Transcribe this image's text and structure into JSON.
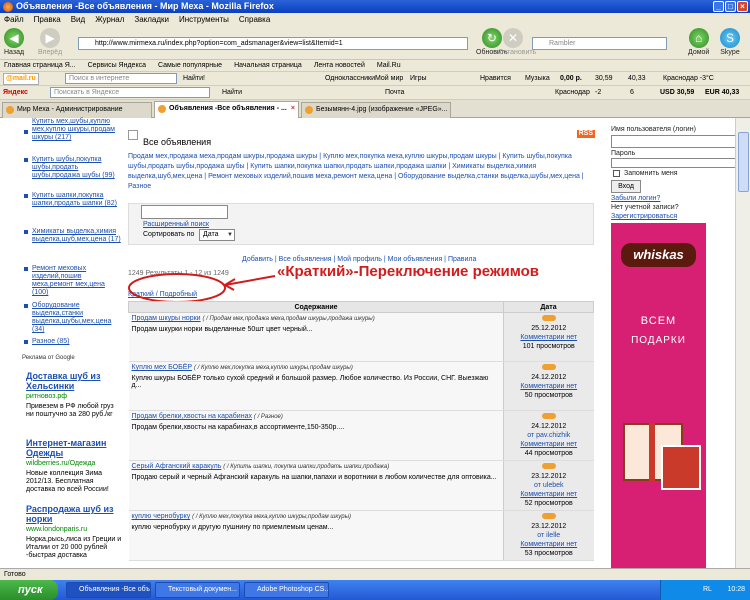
{
  "window": {
    "title": "Объявления -Все объявления - Мир Меха - Mozilla Firefox"
  },
  "menu": [
    "Файл",
    "Правка",
    "Вид",
    "Журнал",
    "Закладки",
    "Инструменты",
    "Справка"
  ],
  "nav": {
    "back": "Назад",
    "forward": "Вперёд",
    "home": "Домой",
    "refresh": "Обновить",
    "stop": "Остановить",
    "skype": "Skype",
    "url": "http://www.mirmexa.ru/index.php?option=com_adsmanager&view=list&Itemid=1",
    "search_placeholder": "Rambler"
  },
  "bookmarks": [
    "Главная страница Я...",
    "Сервисы Яндекса",
    "Самые популярные",
    "Начальная страница",
    "Лента новостей",
    "Mail.Ru"
  ],
  "mailbar": {
    "logo": "@mail.ru",
    "search_placeholder": "Поиск в интернете",
    "find": "Найти!",
    "items": [
      "Одноклассники",
      "Мой мир",
      "Игры",
      "Нравится",
      "Музыка",
      "0,00 р.",
      "30,59",
      "40,33",
      "Краснодар -3°C"
    ]
  },
  "yabar": {
    "logo": "Яндекс",
    "search_placeholder": "Поискать в Яндексе",
    "find": "Найти",
    "mail": "Почта",
    "city": "Краснодар",
    "temp": "-2",
    "num": "6",
    "usd": "USD 30,59",
    "eur": "EUR 40,33"
  },
  "tabs": [
    {
      "label": "Мир Меха - Администрирование"
    },
    {
      "label": "Объявления -Все объявления - ..."
    },
    {
      "label": "Безымянн-4.jpg (изображение «JPEG»..."
    }
  ],
  "left": {
    "nav": [
      {
        "label": "Купить мех,шубы,куплю мех,куплю шкуры,продам шкуры (217)"
      },
      {
        "label": "Купить шубы,покупка шубы,продать шубы,продажа шубы (99)"
      },
      {
        "label": "Купить шапки,покупка шапки,продать шапки (82)"
      },
      {
        "label": "Химикаты выделка,химия выделка,шуб,мех,цена (17)"
      },
      {
        "label": "Ремонт меховых изделий,пошив меха,ремонт мех,цена (100)"
      },
      {
        "label": "Оборудование выделка,станки выделка,шубы,мех,цена (34)"
      },
      {
        "label": "Разное (85)"
      }
    ],
    "ads_label": "Реклама от Google",
    "ads": [
      {
        "title": "Доставка шуб из Хельсинки",
        "url": "pитновоз.рф",
        "text": "Привезем в РФ любой груз ни поштучно за 280 руб./кг"
      },
      {
        "title": "Интернет-магазин Одежды",
        "url": "wildberries.ru/Одежда",
        "text": "Новые коллекция Зима 2012/13. Бесплатная доставка по всей России!"
      },
      {
        "title": "Распродажа шуб из норки",
        "url": "www.londonparis.ru",
        "text": "Норка,рысь,лиса из Греции и Италии от 20 000 рублей -быстрая доставка"
      }
    ]
  },
  "main": {
    "heading": "Все объявления",
    "rss": "RSS",
    "categories": "Продам мех,продажа меха,продам шкуры,продажа шкуры | Куплю мех,покупка меха,куплю шкуры,продам шкуры | Купить шубы,покупка шубы,продать шубы,продажа шубы | Купить шапки,покупка шапки,продать шапки,продажа шапки | Химикаты выделка,химия выделка,шуб,мех,цена | Ремонт меховых изделий,пошив меха,ремонт меха,цена | Оборудование выделка,станки выделка,шубы,мех,цена | Разное",
    "advanced_search": "Расширенный поиск",
    "sort_label": "Сортировать по",
    "sort_value": "Дата",
    "links": "Добавить | Все объявления | Мой профиль | Мои объявления | Правила",
    "results": "1249 Результаты 1 - 12 из 1249",
    "view_switch": "Краткий / Подробный",
    "annotation": "«Краткий»-Переключение режимов",
    "table": {
      "headers": [
        "Содержание",
        "Дата"
      ],
      "rows": [
        {
          "title": "Продам шкуры норки",
          "cat": "( / Продам мех,продажа меха,продам шкуры,продажа шкуры)",
          "text": "Продам шкурки норки выделанные 50шт цвет черный...",
          "date": "25.12.2012",
          "author": "",
          "comments": "Комментарии нет",
          "views": "101 просмотров"
        },
        {
          "title": "Куплю мех БОБЁР",
          "cat": "( / Куплю мех,покупка меха,куплю шкуры,продам шкуры)",
          "text": "Куплю шкуры БОБЁР только сухой средний и большой размер. Любое количество. Из России, СНГ. Выезжаю д...",
          "date": "24.12.2012",
          "author": "",
          "comments": "Комментарии нет",
          "views": "50 просмотров"
        },
        {
          "title": "Продам брелки,хвосты на карабинах",
          "cat": "( / Разное)",
          "text": "Продам брелки,хвосты на карабинах,в ассортименте,150-350р....",
          "date": "24.12.2012",
          "author": "от pav.chizhik",
          "comments": "Комментарии нет",
          "views": "44 просмотров"
        },
        {
          "title": "Серый Афганский каракуль",
          "cat": "( / Купить шапки, покупка шапки,продать шапки,продажа)",
          "text": "Продаю серый и черный Афганский каракуль на шапки,папахи и воротники в любом количестве для оптовика...",
          "date": "23.12.2012",
          "author": "от ulebek",
          "comments": "Комментарии нет",
          "views": "52 просмотров"
        },
        {
          "title": "куплю чернобурку",
          "cat": "( / Куплю мех,покупка меха,куплю шкуры,продам шкуры)",
          "text": "куплю чернобурку и другую пушнину по приемлемым ценам...",
          "date": "23.12.2012",
          "author": "от ilelle",
          "comments": "Комментарии нет",
          "views": "53 просмотров"
        }
      ]
    }
  },
  "right": {
    "username_label": "Имя пользователя (логин)",
    "password_label": "Пароль",
    "remember_label": "Запомнить меня",
    "login_button": "Вход",
    "forgot": "Забыли логин?",
    "no_account": "Нет учетной записи?",
    "register": "Зарегистрироваться",
    "ad": {
      "brand": "whiskas",
      "line1": "ВСЕМ",
      "line2": "ПОДАРКИ"
    }
  },
  "status": "Готово",
  "taskbar": {
    "start": "пуск",
    "tasks": [
      "Объявления -Все объ...",
      "Текстовый докумен...",
      "Adobe Photoshop CS..."
    ],
    "lang": "RL",
    "clock": "10:28"
  }
}
